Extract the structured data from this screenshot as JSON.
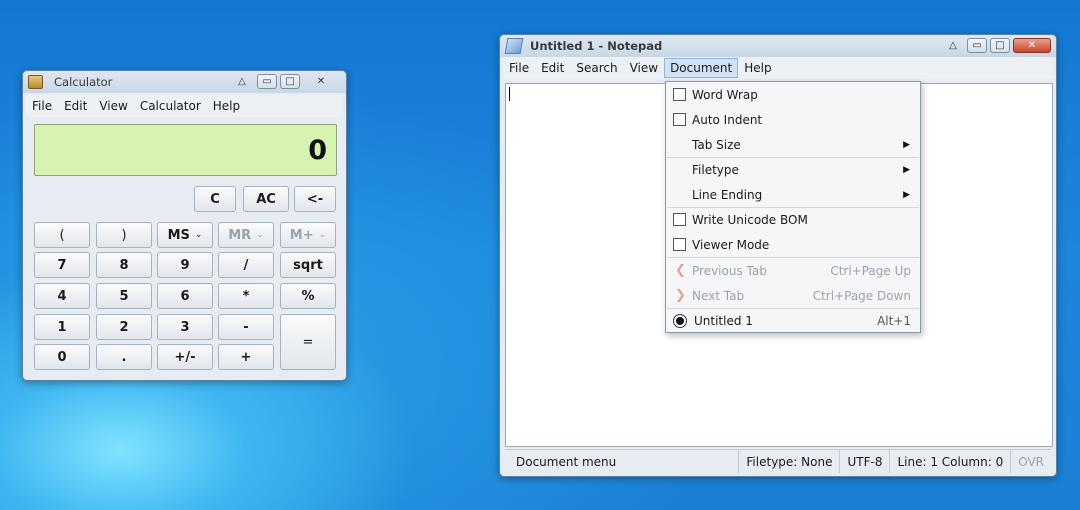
{
  "calculator": {
    "title": "Calculator",
    "menu": [
      "File",
      "Edit",
      "View",
      "Calculator",
      "Help"
    ],
    "display": "0",
    "buttons": {
      "c": "C",
      "ac": "AC",
      "back": "<-",
      "lparen": "(",
      "rparen": ")",
      "ms": "MS",
      "mr": "MR",
      "mplus": "M+",
      "n7": "7",
      "n8": "8",
      "n9": "9",
      "div": "/",
      "sqrt": "sqrt",
      "n4": "4",
      "n5": "5",
      "n6": "6",
      "mul": "*",
      "pct": "%",
      "n1": "1",
      "n2": "2",
      "n3": "3",
      "minus": "-",
      "eq": "=",
      "n0": "0",
      "dot": ".",
      "neg": "+/-",
      "plus": "+"
    }
  },
  "notepad": {
    "title": "Untitled 1 - Notepad",
    "menu": [
      "File",
      "Edit",
      "Search",
      "View",
      "Document",
      "Help"
    ],
    "active_menu": "Document",
    "status": {
      "message": "Document menu",
      "filetype": "Filetype: None",
      "encoding": "UTF-8",
      "position": "Line: 1 Column: 0",
      "mode": "OVR"
    }
  },
  "document_menu": {
    "word_wrap": "Word Wrap",
    "auto_indent": "Auto Indent",
    "tab_size": "Tab Size",
    "filetype": "Filetype",
    "line_ending": "Line Ending",
    "write_bom": "Write Unicode BOM",
    "viewer_mode": "Viewer Mode",
    "previous_tab": "Previous Tab",
    "previous_tab_shortcut": "Ctrl+Page Up",
    "next_tab": "Next Tab",
    "next_tab_shortcut": "Ctrl+Page Down",
    "untitled": "Untitled 1",
    "untitled_shortcut": "Alt+1"
  },
  "icons": {
    "submenu_arrow": "▶",
    "prev": "❮",
    "next": "❯",
    "chevron": "⌄",
    "minimize": "▭",
    "maximize": "□",
    "close": "✕",
    "shade": "△"
  }
}
